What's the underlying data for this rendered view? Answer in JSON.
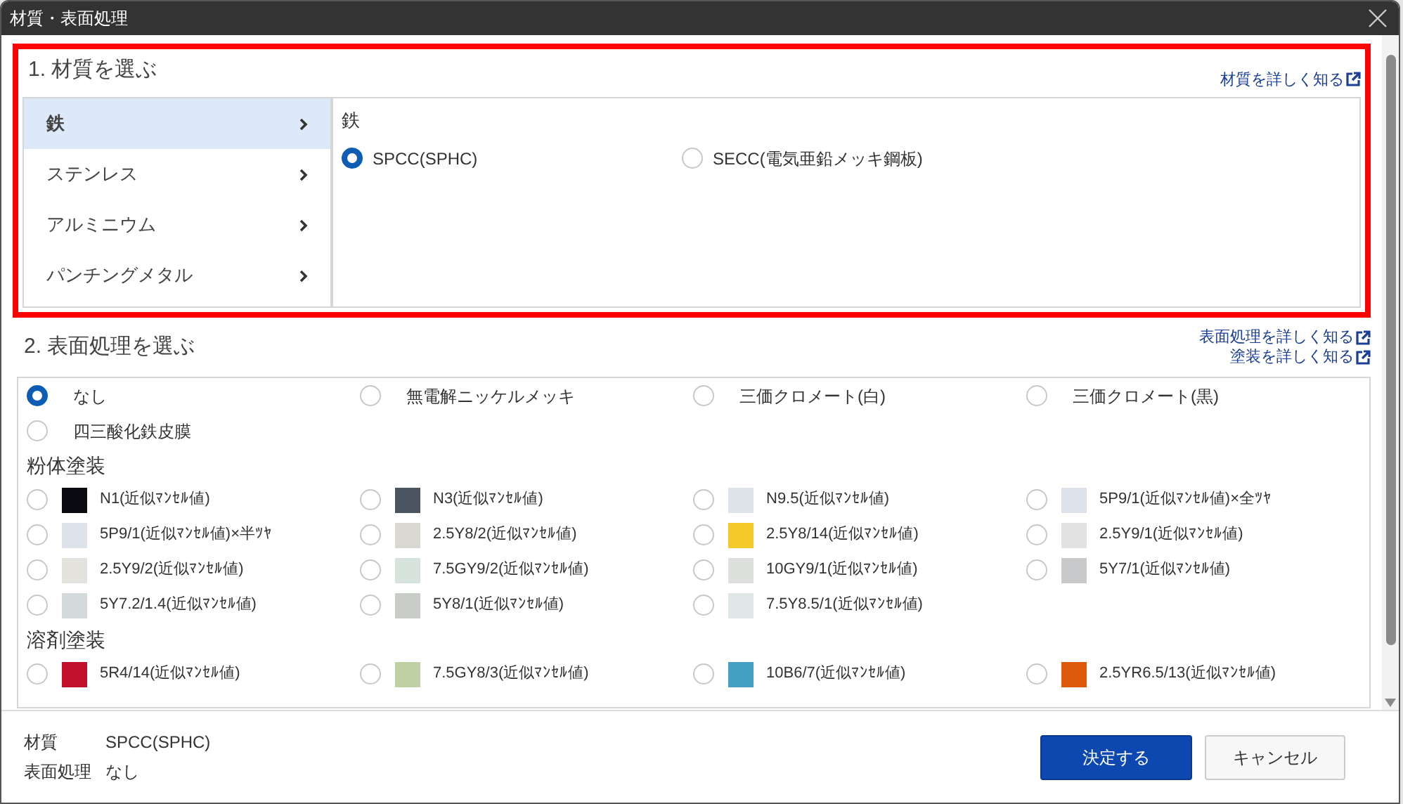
{
  "window": {
    "title": "材質・表面処理"
  },
  "material": {
    "title": "1. 材質を選ぶ",
    "link": "材質を詳しく知る",
    "categories": [
      {
        "label": "鉄",
        "selected": true
      },
      {
        "label": "ステンレス",
        "selected": false
      },
      {
        "label": "アルミニウム",
        "selected": false
      },
      {
        "label": "パンチングメタル",
        "selected": false
      }
    ],
    "panel_title": "鉄",
    "options": [
      {
        "label": "SPCC(SPHC)",
        "selected": true
      },
      {
        "label": "SECC(電気亜鉛メッキ鋼板)",
        "selected": false
      }
    ]
  },
  "surface": {
    "title": "2. 表面処理を選ぶ",
    "links": [
      "表面処理を詳しく知る",
      "塗装を詳しく知る"
    ],
    "groups": [
      {
        "options": [
          {
            "kind": "plain",
            "label": "なし",
            "selected": true
          },
          {
            "kind": "plain",
            "label": "無電解ニッケルメッキ",
            "selected": false
          },
          {
            "kind": "plain",
            "label": "三価クロメート(白)",
            "selected": false
          },
          {
            "kind": "plain",
            "label": "三価クロメート(黒)",
            "selected": false
          },
          {
            "kind": "plain",
            "label": "四三酸化鉄皮膜",
            "selected": false
          }
        ]
      },
      {
        "heading": "粉体塗装",
        "options": [
          {
            "kind": "swatch",
            "label": "N1(近似ﾏﾝｾﾙ値)",
            "selected": false,
            "color": "#0a0b10"
          },
          {
            "kind": "swatch",
            "label": "N3(近似ﾏﾝｾﾙ値)",
            "selected": false,
            "color": "#4a5560"
          },
          {
            "kind": "swatch",
            "label": "N9.5(近似ﾏﾝｾﾙ値)",
            "selected": false,
            "color": "#dde3e8"
          },
          {
            "kind": "swatch",
            "label": "5P9/1(近似ﾏﾝｾﾙ値)×全ﾂﾔ",
            "selected": false,
            "color": "#dce1ea"
          },
          {
            "kind": "swatch",
            "label": "5P9/1(近似ﾏﾝｾﾙ値)×半ﾂﾔ",
            "selected": false,
            "color": "#dde2eb"
          },
          {
            "kind": "swatch",
            "label": "2.5Y8/2(近似ﾏﾝｾﾙ値)",
            "selected": false,
            "color": "#d8d8d0"
          },
          {
            "kind": "swatch",
            "label": "2.5Y8/14(近似ﾏﾝｾﾙ値)",
            "selected": false,
            "color": "#f5c92a"
          },
          {
            "kind": "swatch",
            "label": "2.5Y9/1(近似ﾏﾝｾﾙ値)",
            "selected": false,
            "color": "#e2e2e3"
          },
          {
            "kind": "swatch",
            "label": "2.5Y9/2(近似ﾏﾝｾﾙ値)",
            "selected": false,
            "color": "#e4e2dc"
          },
          {
            "kind": "swatch",
            "label": "7.5GY9/2(近似ﾏﾝｾﾙ値)",
            "selected": false,
            "color": "#d5e3dc"
          },
          {
            "kind": "swatch",
            "label": "10GY9/1(近似ﾏﾝｾﾙ値)",
            "selected": false,
            "color": "#dcdfdc"
          },
          {
            "kind": "swatch",
            "label": "5Y7/1(近似ﾏﾝｾﾙ値)",
            "selected": false,
            "color": "#c8c9cb"
          },
          {
            "kind": "swatch",
            "label": "5Y7.2/1.4(近似ﾏﾝｾﾙ値)",
            "selected": false,
            "color": "#d4d9db"
          },
          {
            "kind": "swatch",
            "label": "5Y8/1(近似ﾏﾝｾﾙ値)",
            "selected": false,
            "color": "#c8ccc6"
          },
          {
            "kind": "swatch",
            "label": "7.5Y8.5/1(近似ﾏﾝｾﾙ値)",
            "selected": false,
            "color": "#e0e5e5"
          }
        ]
      },
      {
        "heading": "溶剤塗装",
        "options": [
          {
            "kind": "swatch",
            "label": "5R4/14(近似ﾏﾝｾﾙ値)",
            "selected": false,
            "color": "#c0102a"
          },
          {
            "kind": "swatch",
            "label": "7.5GY8/3(近似ﾏﾝｾﾙ値)",
            "selected": false,
            "color": "#bfd0a3"
          },
          {
            "kind": "swatch",
            "label": "10B6/7(近似ﾏﾝｾﾙ値)",
            "selected": false,
            "color": "#43a0c4"
          },
          {
            "kind": "swatch",
            "label": "2.5YR6.5/13(近似ﾏﾝｾﾙ値)",
            "selected": false,
            "color": "#dd5a0a"
          }
        ]
      }
    ]
  },
  "summary": [
    {
      "label": "材質",
      "value": "SPCC(SPHC)"
    },
    {
      "label": "表面処理",
      "value": "なし"
    }
  ],
  "buttons": [
    {
      "kind": "primary",
      "label": "決定する"
    },
    {
      "kind": "secondary",
      "label": "キャンセル"
    }
  ]
}
